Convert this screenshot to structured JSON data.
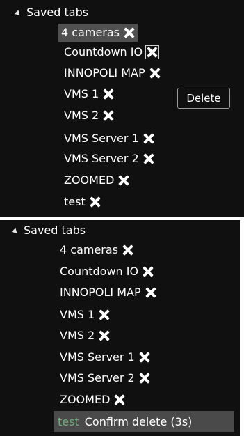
{
  "panel_a": {
    "header": "Saved tabs",
    "items": [
      {
        "label": "4 cameras"
      },
      {
        "label": "Countdown IO"
      },
      {
        "label": "INNOPOLI MAP"
      },
      {
        "label": "VMS 1"
      },
      {
        "label": "VMS 2"
      },
      {
        "label": "VMS Server 1"
      },
      {
        "label": "VMS Server 2"
      },
      {
        "label": "ZOOMED"
      },
      {
        "label": "test"
      }
    ],
    "tooltip": "Delete"
  },
  "panel_b": {
    "header": "Saved tabs",
    "items": [
      {
        "label": "4 cameras"
      },
      {
        "label": "Countdown IO"
      },
      {
        "label": "INNOPOLI MAP"
      },
      {
        "label": "VMS 1"
      },
      {
        "label": "VMS 2"
      },
      {
        "label": "VMS Server 1"
      },
      {
        "label": "VMS Server 2"
      },
      {
        "label": "ZOOMED"
      }
    ],
    "confirm_row": {
      "label": "test",
      "confirm": "Confirm delete (3s)"
    }
  },
  "icons": {
    "delete": "close-x-icon",
    "expand": "triangle-collapse-icon"
  }
}
